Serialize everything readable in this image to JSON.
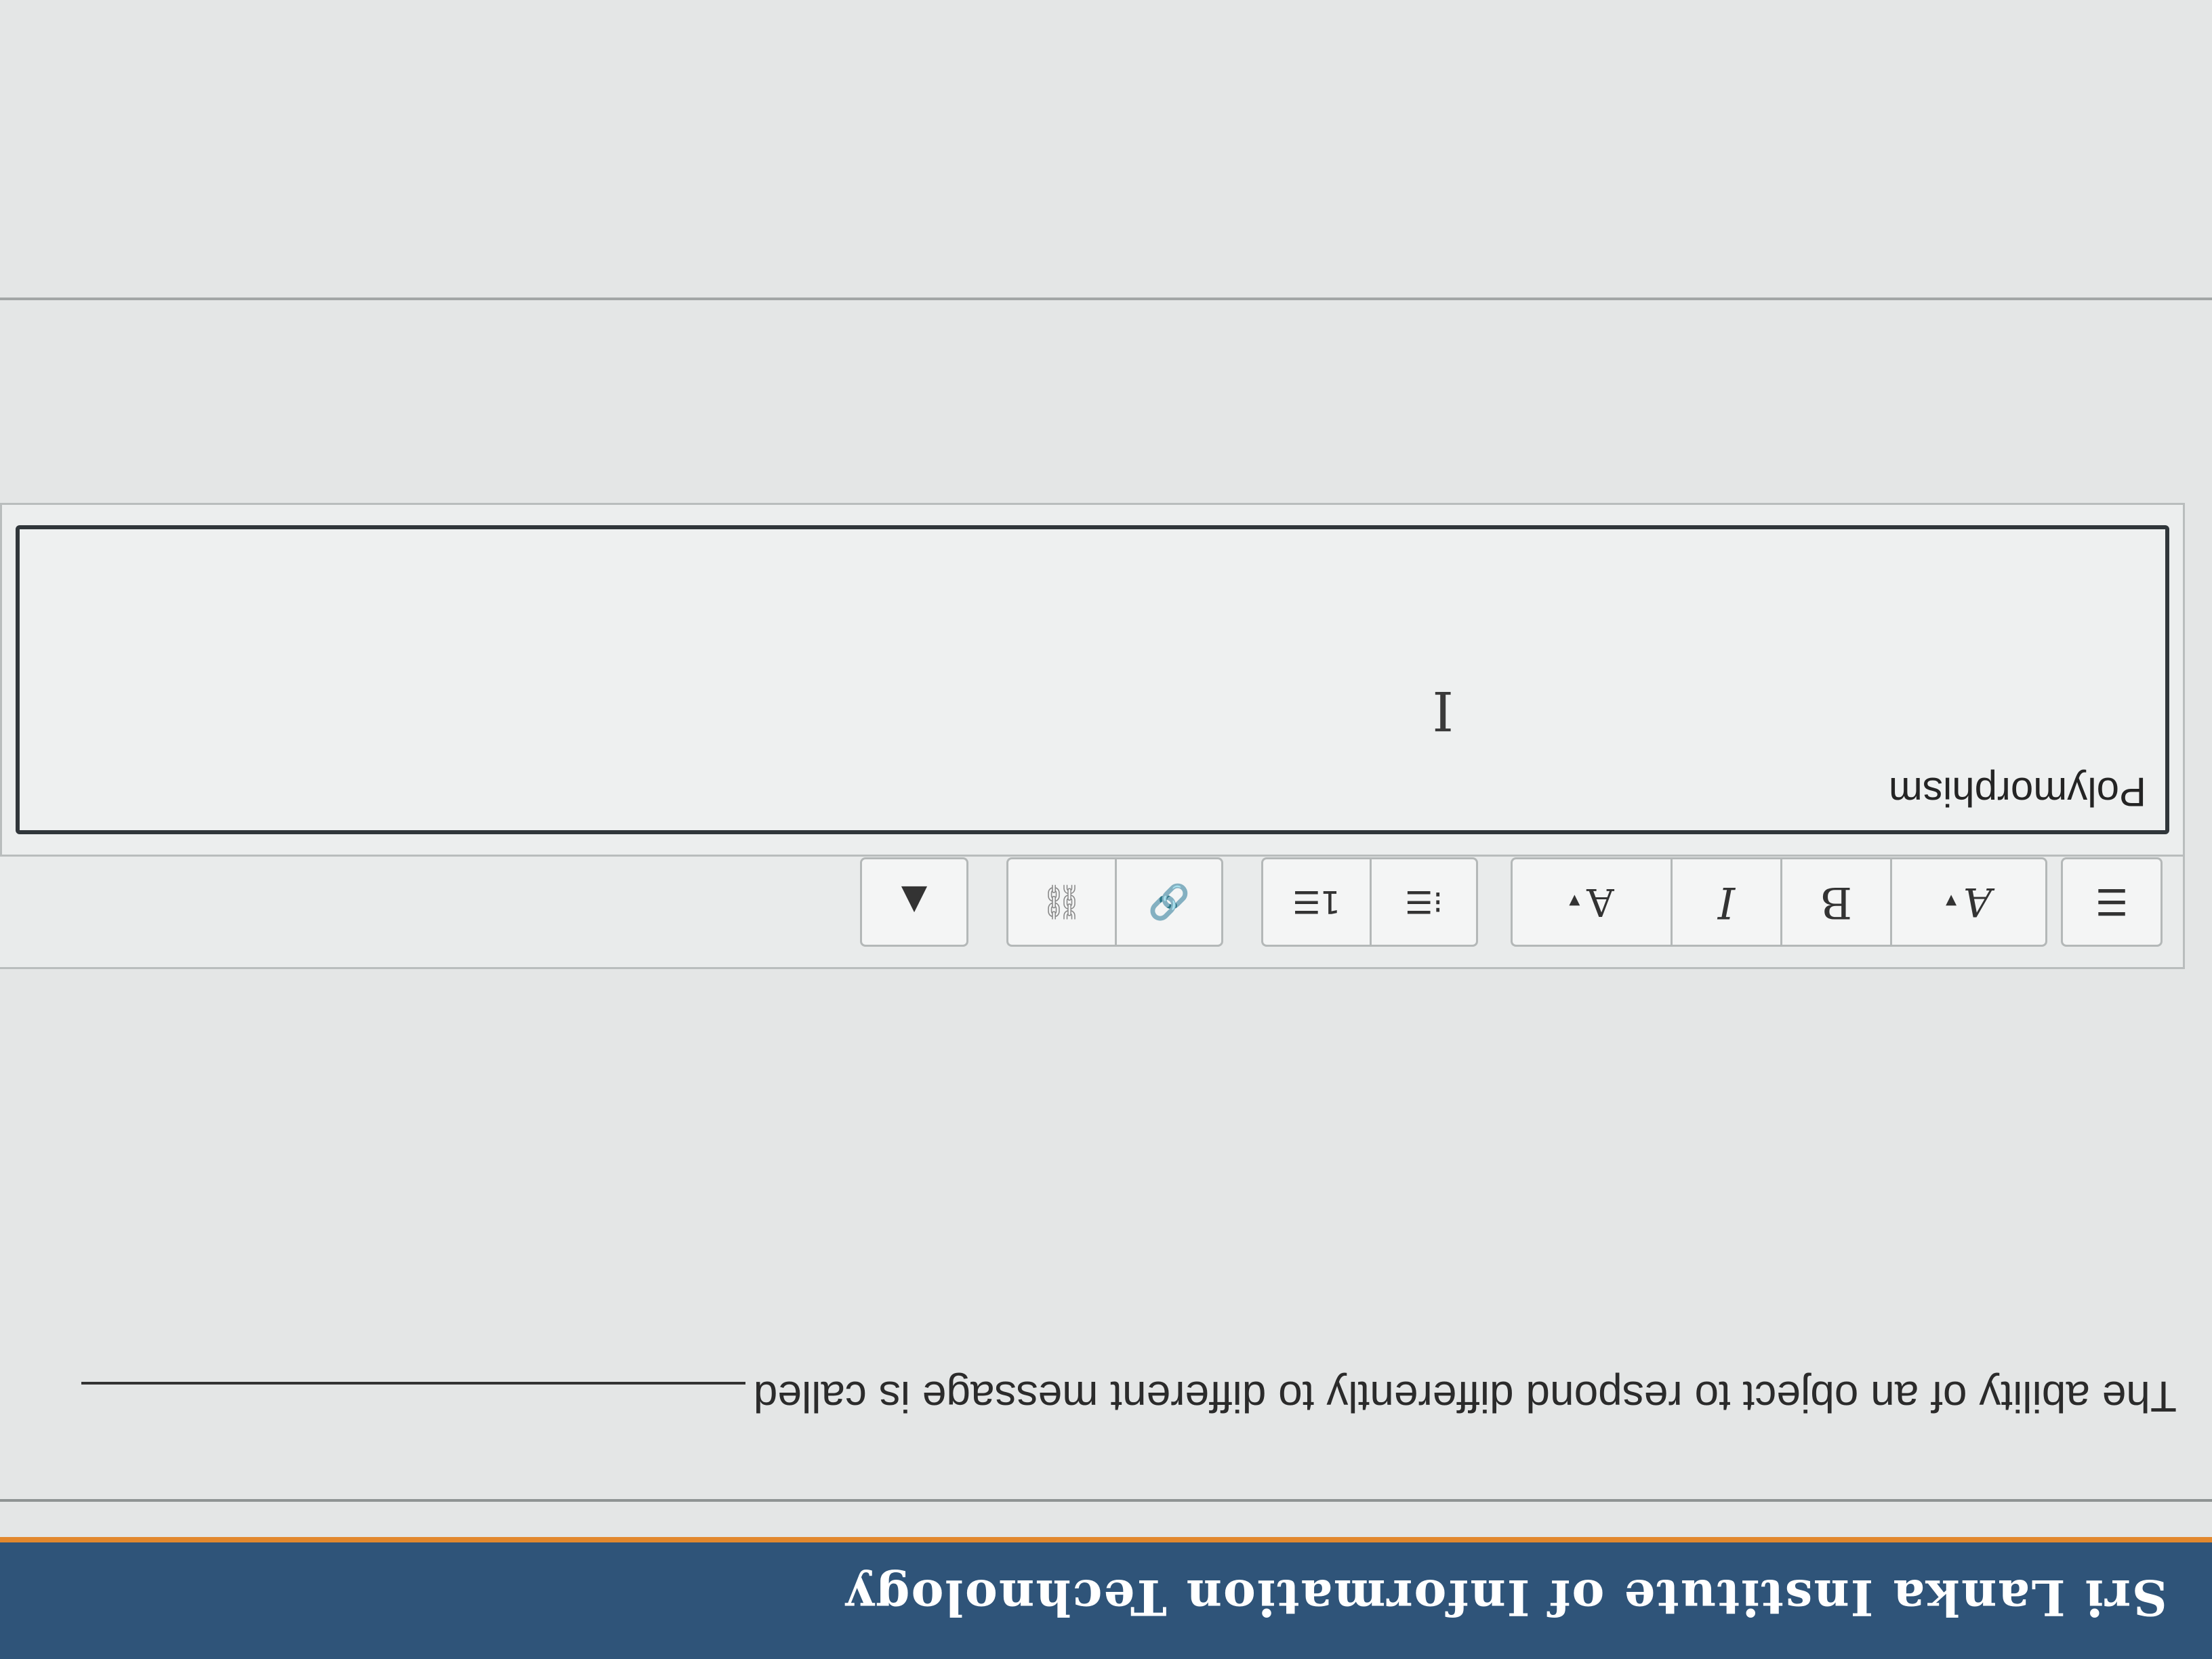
{
  "header": {
    "title": "Sri Lanka Institute of Information Technology"
  },
  "question": {
    "text": "The ability of an object to respond differently to different message is called"
  },
  "toolbar": {
    "buttons": [
      {
        "name": "show-more-buttons",
        "icon": "toolbar-toggle-icon",
        "glyph": "☰"
      },
      {
        "name": "paragraph-styles",
        "icon": "paragraph-styles-icon",
        "glyph": "A",
        "dropdown": "▾"
      },
      {
        "name": "bold",
        "icon": "bold-icon",
        "glyph": "B"
      },
      {
        "name": "italic",
        "icon": "italic-icon",
        "glyph": "I"
      },
      {
        "name": "font-color",
        "icon": "font-color-icon",
        "glyph": "A",
        "dropdown": "▾"
      },
      {
        "name": "unordered-list",
        "icon": "bullet-list-icon",
        "glyph": "⁝☰"
      },
      {
        "name": "ordered-list",
        "icon": "numbered-list-icon",
        "glyph": "1☰"
      },
      {
        "name": "link",
        "icon": "link-icon",
        "glyph": "🔗"
      },
      {
        "name": "unlink",
        "icon": "unlink-icon",
        "glyph": "⛓"
      },
      {
        "name": "insert-image",
        "icon": "image-icon",
        "glyph": "▲"
      }
    ]
  },
  "editor": {
    "answer_text": "Polymorphism",
    "cursor_glyph": "I"
  }
}
